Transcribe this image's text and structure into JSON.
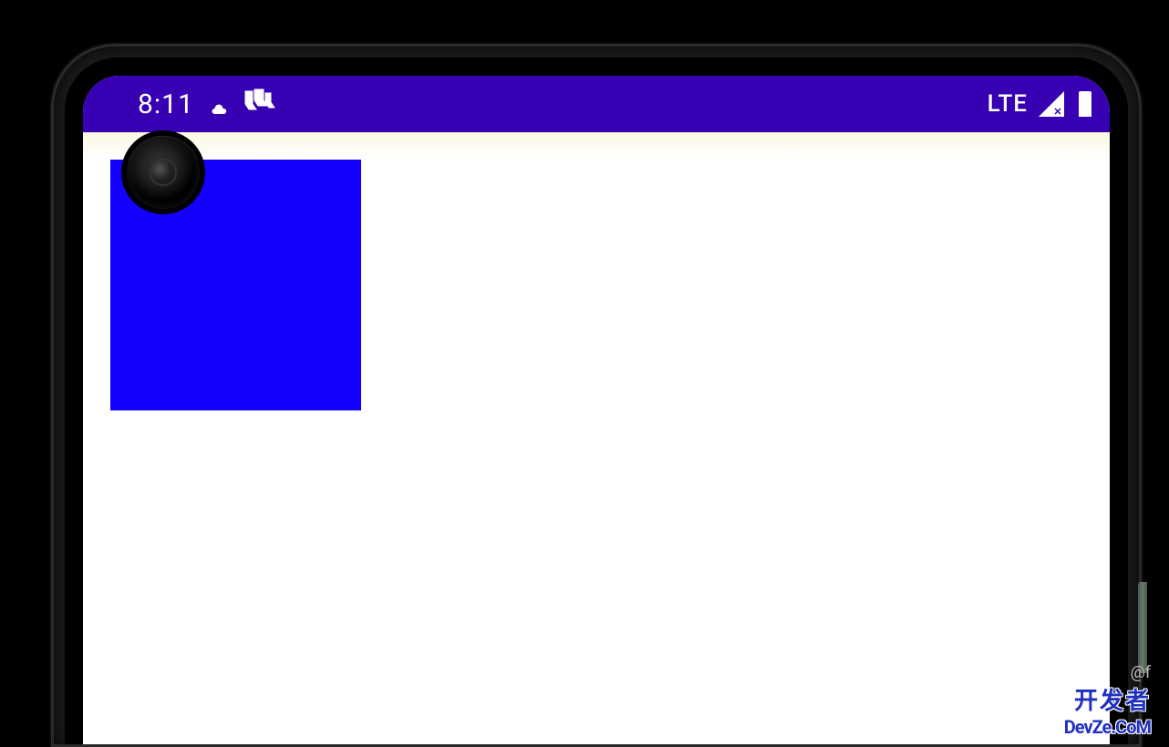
{
  "status_bar": {
    "time": "8:11",
    "network": "LTE"
  },
  "content": {
    "square_color": "#1400FF"
  },
  "watermark": {
    "prefix": "@f",
    "line_cn": "开发者",
    "line_en": "DevZe.CoM"
  }
}
